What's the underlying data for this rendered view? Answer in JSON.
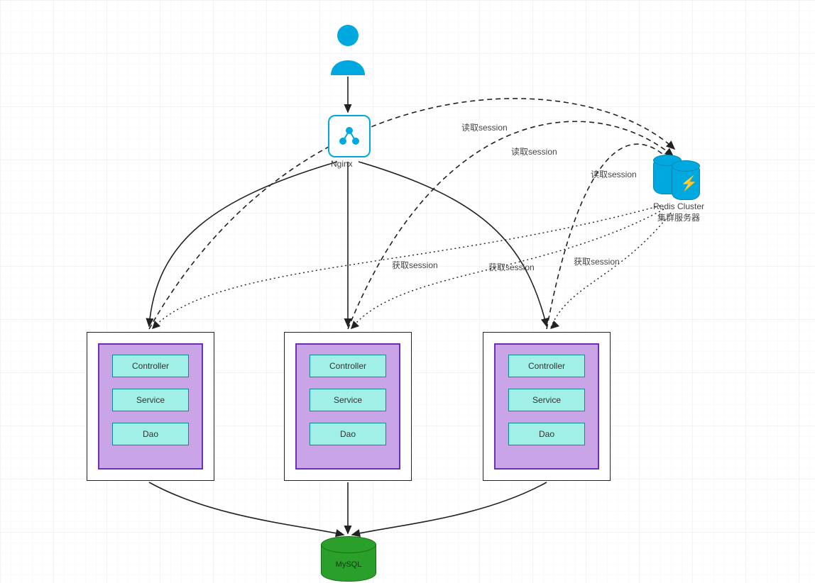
{
  "colors": {
    "accent_blue": "#00a8e0",
    "grid_light": "#f0f3f5",
    "grid_mid": "#e6ecef",
    "purple_border": "#6d2fb8",
    "purple_fill": "#c9a5e8",
    "teal_border": "#0b8b8f",
    "teal_fill": "#a0f0e8",
    "mysql_green": "#2aa02a"
  },
  "nodes": {
    "nginx": {
      "label": "Nginx"
    },
    "redis": {
      "title": "Redis Cluster",
      "subtitle": "集群服务器"
    },
    "mysql": {
      "label": "MySQL"
    },
    "layers": {
      "controller": "Controller",
      "service": "Service",
      "dao": "Dao"
    }
  },
  "edge_labels": {
    "read1": "读取session",
    "read2": "读取session",
    "read3": "读取session",
    "get1": "获取session",
    "get2": "获取session",
    "get3": "获取session"
  },
  "chart_data": {
    "type": "diagram",
    "title": "Nginx load-balanced app servers with shared Redis session store and MySQL",
    "nodes": [
      {
        "id": "user",
        "type": "actor",
        "label": ""
      },
      {
        "id": "nginx",
        "type": "proxy",
        "label": "Nginx"
      },
      {
        "id": "app1",
        "type": "app-server",
        "layers": [
          "Controller",
          "Service",
          "Dao"
        ]
      },
      {
        "id": "app2",
        "type": "app-server",
        "layers": [
          "Controller",
          "Service",
          "Dao"
        ]
      },
      {
        "id": "app3",
        "type": "app-server",
        "layers": [
          "Controller",
          "Service",
          "Dao"
        ]
      },
      {
        "id": "redis",
        "type": "cache-cluster",
        "label": "Redis Cluster 集群服务器"
      },
      {
        "id": "mysql",
        "type": "database",
        "label": "MySQL"
      }
    ],
    "edges": [
      {
        "from": "user",
        "to": "nginx",
        "style": "solid"
      },
      {
        "from": "nginx",
        "to": "app1",
        "style": "solid"
      },
      {
        "from": "nginx",
        "to": "app2",
        "style": "solid"
      },
      {
        "from": "nginx",
        "to": "app3",
        "style": "solid"
      },
      {
        "from": "app1",
        "to": "redis",
        "style": "dashed",
        "label": "读取session"
      },
      {
        "from": "app2",
        "to": "redis",
        "style": "dashed",
        "label": "读取session"
      },
      {
        "from": "app3",
        "to": "redis",
        "style": "dashed",
        "label": "读取session"
      },
      {
        "from": "redis",
        "to": "app1",
        "style": "dotted",
        "label": "获取session"
      },
      {
        "from": "redis",
        "to": "app2",
        "style": "dotted",
        "label": "获取session"
      },
      {
        "from": "redis",
        "to": "app3",
        "style": "dotted",
        "label": "获取session"
      },
      {
        "from": "app1",
        "to": "mysql",
        "style": "solid"
      },
      {
        "from": "app2",
        "to": "mysql",
        "style": "solid"
      },
      {
        "from": "app3",
        "to": "mysql",
        "style": "solid"
      }
    ]
  }
}
